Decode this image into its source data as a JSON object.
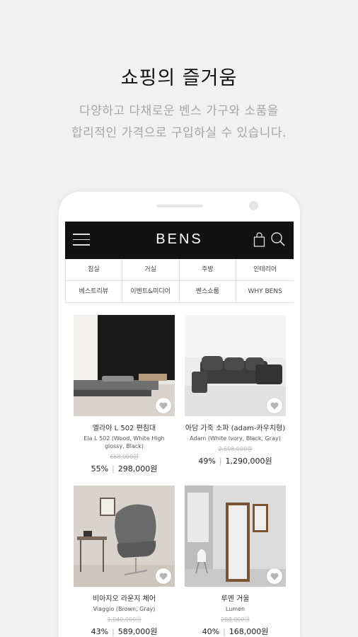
{
  "headline": "쇼핑의 즐거움",
  "subtitle_line1": "다양하고 다채로운 벤스 가구와 소품을",
  "subtitle_line2": "합리적인 가격으로 구입하실 수 있습니다.",
  "app": {
    "logo": "BENS",
    "categories": [
      "침실",
      "거실",
      "주방",
      "인테리어",
      "베스트리뷰",
      "이벤트&미디어",
      "벤스쇼룸",
      "WHY BENS"
    ]
  },
  "products": [
    {
      "name": "엘라아 L 502 편침대",
      "desc": "Ela L 502 (Wood, White High glossy, Black)",
      "original": "668,000원",
      "discount": "55%",
      "price": "298,000원"
    },
    {
      "name": "아담 가죽 소파 (adam-카우치형)",
      "desc": "Adam (White Ivory, Black, Gray)",
      "original": "2,508,000원",
      "discount": "49%",
      "price": "1,290,000원"
    },
    {
      "name": "비아지오 라운지 체어",
      "desc": "Viaggio (Brown, Gray)",
      "original": "1,040,000원",
      "discount": "43%",
      "price": "589,000원"
    },
    {
      "name": "루멘 거울",
      "desc": "Lumen",
      "original": "280,000원",
      "discount": "40%",
      "price": "168,000원"
    }
  ]
}
